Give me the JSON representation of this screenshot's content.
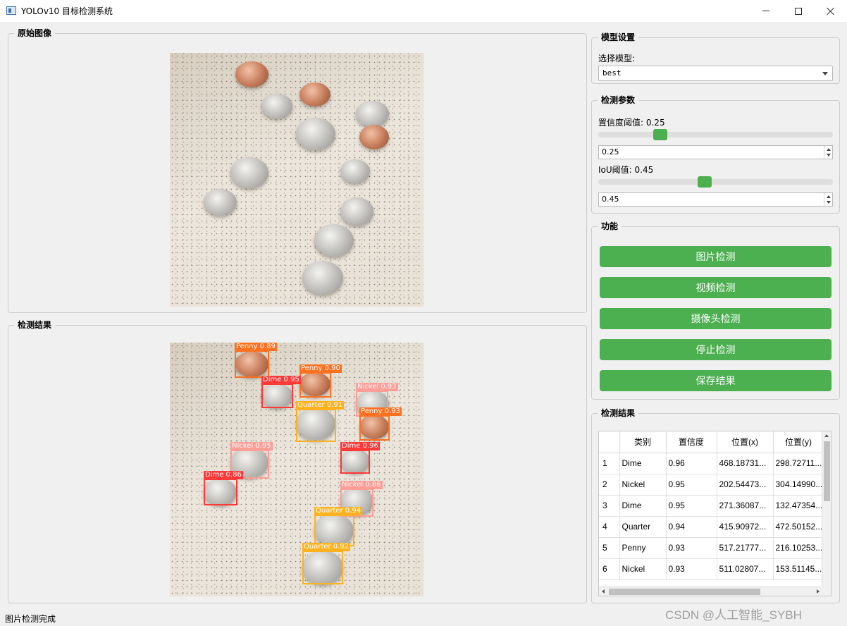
{
  "window": {
    "title": "YOLOv10 目标检测系统",
    "minimize_icon": "minimize-icon",
    "maximize_icon": "maximize-icon",
    "close_icon": "close-icon"
  },
  "original_panel": {
    "title": "原始图像"
  },
  "result_image_panel": {
    "title": "检测结果"
  },
  "model_settings": {
    "title": "模型设置",
    "select_label": "选择模型:",
    "selected_model": "best"
  },
  "params": {
    "title": "检测参数",
    "conf_label": "置信度阈值: 0.25",
    "conf_value": "0.25",
    "conf_level": 0.25,
    "iou_label": "IoU阈值: 0.45",
    "iou_value": "0.45",
    "iou_level": 0.45
  },
  "functions": {
    "title": "功能",
    "image_detect": "图片检测",
    "video_detect": "视频检测",
    "camera_detect": "摄像头检测",
    "stop_detect": "停止检测",
    "save_results": "保存结果"
  },
  "detections": [
    {
      "label": "Penny 0.89",
      "color": "#ff701f"
    },
    {
      "label": "Penny 0.90",
      "color": "#ff701f"
    },
    {
      "label": "Dime 0.95",
      "color": "#ff3838"
    },
    {
      "label": "Nickel 0.93",
      "color": "#ff9d97"
    },
    {
      "label": "Quarter 0.91",
      "color": "#ffb21d"
    },
    {
      "label": "Penny 0.93",
      "color": "#ff701f"
    },
    {
      "label": "Nickel 0.95",
      "color": "#ff9d97"
    },
    {
      "label": "Dime 0.96",
      "color": "#ff3838"
    },
    {
      "label": "Dime 0.86",
      "color": "#ff3838"
    },
    {
      "label": "Nickel 0.86",
      "color": "#ff9d97"
    },
    {
      "label": "Quarter 0.94",
      "color": "#ffb21d"
    },
    {
      "label": "Quarter 0.92",
      "color": "#ffb21d"
    }
  ],
  "results_table": {
    "title": "检测结果",
    "headers": [
      "类别",
      "置信度",
      "位置(x)",
      "位置(y)"
    ],
    "rows": [
      {
        "num": "1",
        "cls": "Dime",
        "conf": "0.96",
        "x": "468.18731...",
        "y": "298.72711..."
      },
      {
        "num": "2",
        "cls": "Nickel",
        "conf": "0.95",
        "x": "202.54473...",
        "y": "304.14990..."
      },
      {
        "num": "3",
        "cls": "Dime",
        "conf": "0.95",
        "x": "271.36087...",
        "y": "132.47354..."
      },
      {
        "num": "4",
        "cls": "Quarter",
        "conf": "0.94",
        "x": "415.90972...",
        "y": "472.50152..."
      },
      {
        "num": "5",
        "cls": "Penny",
        "conf": "0.93",
        "x": "517.21777...",
        "y": "216.10253..."
      },
      {
        "num": "6",
        "cls": "Nickel",
        "conf": "0.93",
        "x": "511.02807...",
        "y": "153.51145..."
      }
    ]
  },
  "status": "图片检测完成",
  "watermark": "CSDN @人工智能_SYBH",
  "colors": {
    "accent": "#4caf50"
  }
}
